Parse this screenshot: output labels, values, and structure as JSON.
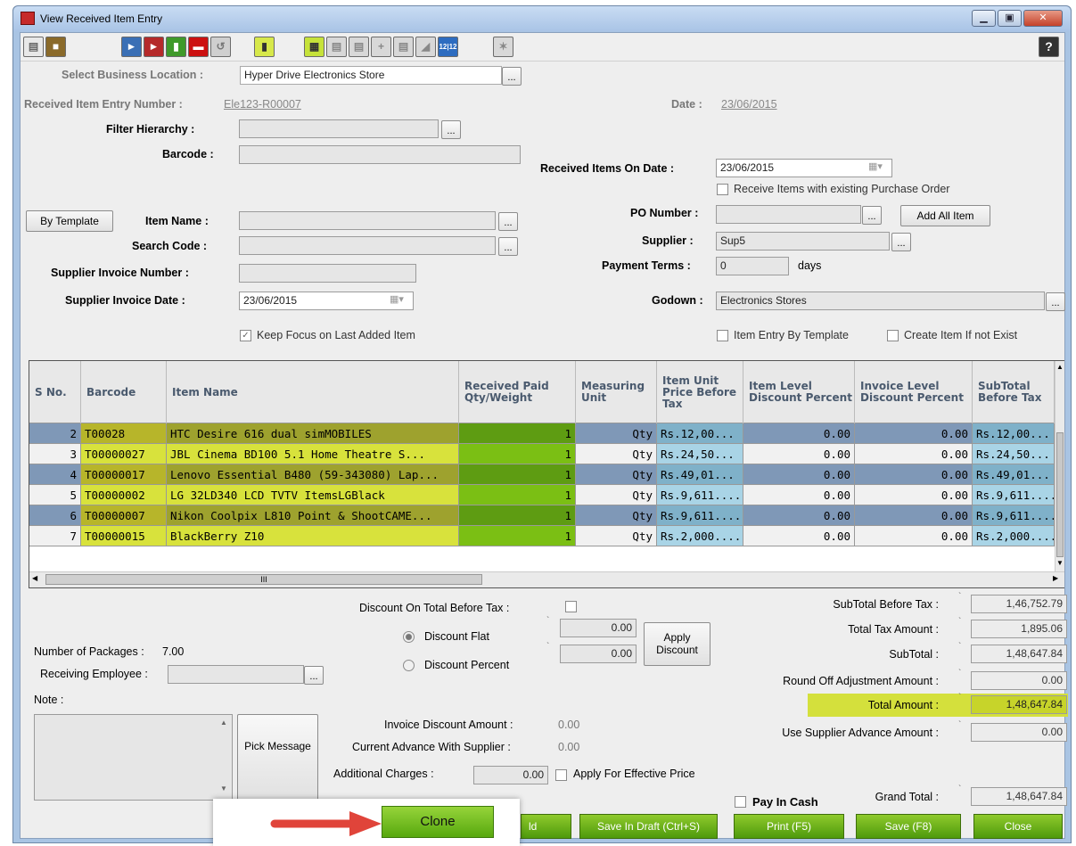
{
  "window": {
    "title": "View Received Item Entry",
    "controls": [
      "▁",
      "▣",
      "✕"
    ]
  },
  "toolbar": {
    "help_label": "?",
    "date_btn_label": "12|12"
  },
  "form": {
    "business_location_label": "Select Business Location :",
    "business_location_value": "Hyper Drive Electronics Store",
    "entry_number_label": "Received Item Entry Number :",
    "entry_number_value": "Ele123-R00007",
    "date_label": "Date :",
    "date_value": "23/06/2015",
    "filter_hierarchy_label": "Filter Hierarchy :",
    "barcode_label": "Barcode :",
    "by_template_button": "By Template",
    "item_name_label": "Item Name :",
    "search_code_label": "Search Code :",
    "supplier_invoice_number_label": "Supplier Invoice Number :",
    "supplier_invoice_date_label": "Supplier Invoice Date :",
    "supplier_invoice_date_value": "23/06/2015",
    "keep_focus_label": "Keep Focus on Last Added Item",
    "received_on_date_label": "Received Items On Date :",
    "received_on_date_value": "23/06/2015",
    "receive_with_po_label": "Receive Items with existing Purchase Order",
    "po_number_label": "PO Number :",
    "add_all_item_button": "Add All Item",
    "supplier_label": "Supplier :",
    "supplier_value": "Sup5",
    "payment_terms_label": "Payment Terms :",
    "payment_terms_value": "0",
    "days_label": "days",
    "godown_label": "Godown :",
    "godown_value": "Electronics Stores",
    "item_entry_by_template_label": "Item Entry By Template",
    "create_item_label": "Create Item If not Exist",
    "dots": "..."
  },
  "grid": {
    "headers": [
      "S No.",
      "Barcode",
      "Item Name",
      "Received Paid Qty/Weight",
      "Measuring Unit",
      "Item Unit Price Before Tax",
      "Item Level Discount Percent",
      "Invoice Level Discount Percent",
      "SubTotal Before Tax"
    ],
    "rows": [
      {
        "sno": "2",
        "barcode": "T00028",
        "name": "HTC Desire 616 dual simMOBILES",
        "qty": "1",
        "unit": "Qty",
        "price": "Rs.12,00...",
        "item_disc": "0.00",
        "inv_disc": "0.00",
        "subtotal": "Rs.12,00..."
      },
      {
        "sno": "3",
        "barcode": "T00000027",
        "name": "JBL Cinema BD100 5.1 Home Theatre S...",
        "qty": "1",
        "unit": "Qty",
        "price": "Rs.24,50...",
        "item_disc": "0.00",
        "inv_disc": "0.00",
        "subtotal": "Rs.24,50..."
      },
      {
        "sno": "4",
        "barcode": "T00000017",
        "name": "Lenovo Essential B480 (59-343080) Lap...",
        "qty": "1",
        "unit": "Qty",
        "price": "Rs.49,01...",
        "item_disc": "0.00",
        "inv_disc": "0.00",
        "subtotal": "Rs.49,01..."
      },
      {
        "sno": "5",
        "barcode": "T00000002",
        "name": "LG 32LD340 LCD TVTV ItemsLGBlack",
        "qty": "1",
        "unit": "Qty",
        "price": "Rs.9,611....",
        "item_disc": "0.00",
        "inv_disc": "0.00",
        "subtotal": "Rs.9,611...."
      },
      {
        "sno": "6",
        "barcode": "T00000007",
        "name": "Nikon Coolpix L810 Point & ShootCAME...",
        "qty": "1",
        "unit": "Qty",
        "price": "Rs.9,611....",
        "item_disc": "0.00",
        "inv_disc": "0.00",
        "subtotal": "Rs.9,611...."
      },
      {
        "sno": "7",
        "barcode": "T00000015",
        "name": "BlackBerry Z10",
        "qty": "1",
        "unit": "Qty",
        "price": "Rs.2,000....",
        "item_disc": "0.00",
        "inv_disc": "0.00",
        "subtotal": "Rs.2,000...."
      }
    ],
    "hscroll_grip": "III"
  },
  "bottom": {
    "discount_on_total_label": "Discount On Total Before Tax :",
    "discount_flat_label": "Discount Flat",
    "discount_percent_label": "Discount Percent",
    "discount_flat_value": "0.00",
    "discount_percent_value": "0.00",
    "apply_discount_button": "Apply Discount",
    "packages_label": "Number of Packages :",
    "packages_value": "7.00",
    "receiving_employee_label": "Receiving Employee :",
    "note_label": "Note :",
    "pick_message_button": "Pick Message",
    "invoice_discount_label": "Invoice Discount Amount :",
    "invoice_discount_value": "0.00",
    "advance_label": "Current Advance With Supplier :",
    "advance_value": "0.00",
    "additional_charges_label": "Additional Charges :",
    "additional_charges_value": "0.00",
    "apply_effective_label": "Apply For Effective Price",
    "pay_in_cash_label": "Pay In Cash",
    "currency_mark": "`"
  },
  "totals": {
    "subtotal_before_tax_label": "SubTotal Before Tax :",
    "subtotal_before_tax_value": "1,46,752.79",
    "total_tax_label": "Total Tax Amount :",
    "total_tax_value": "1,895.06",
    "subtotal_label": "SubTotal :",
    "subtotal_value": "1,48,647.84",
    "round_off_label": "Round Off Adjustment Amount :",
    "round_off_value": "0.00",
    "total_amount_label": "Total Amount :",
    "total_amount_value": "1,48,647.84",
    "use_advance_label": "Use Supplier Advance Amount :",
    "use_advance_value": "0.00",
    "grand_total_label": "Grand Total :",
    "grand_total_value": "1,48,647.84"
  },
  "buttons": {
    "clone": "Clone",
    "hold": "ld",
    "save_draft": "Save In Draft (Ctrl+S)",
    "print": "Print (F5)",
    "save": "Save (F8)",
    "close": "Close"
  }
}
